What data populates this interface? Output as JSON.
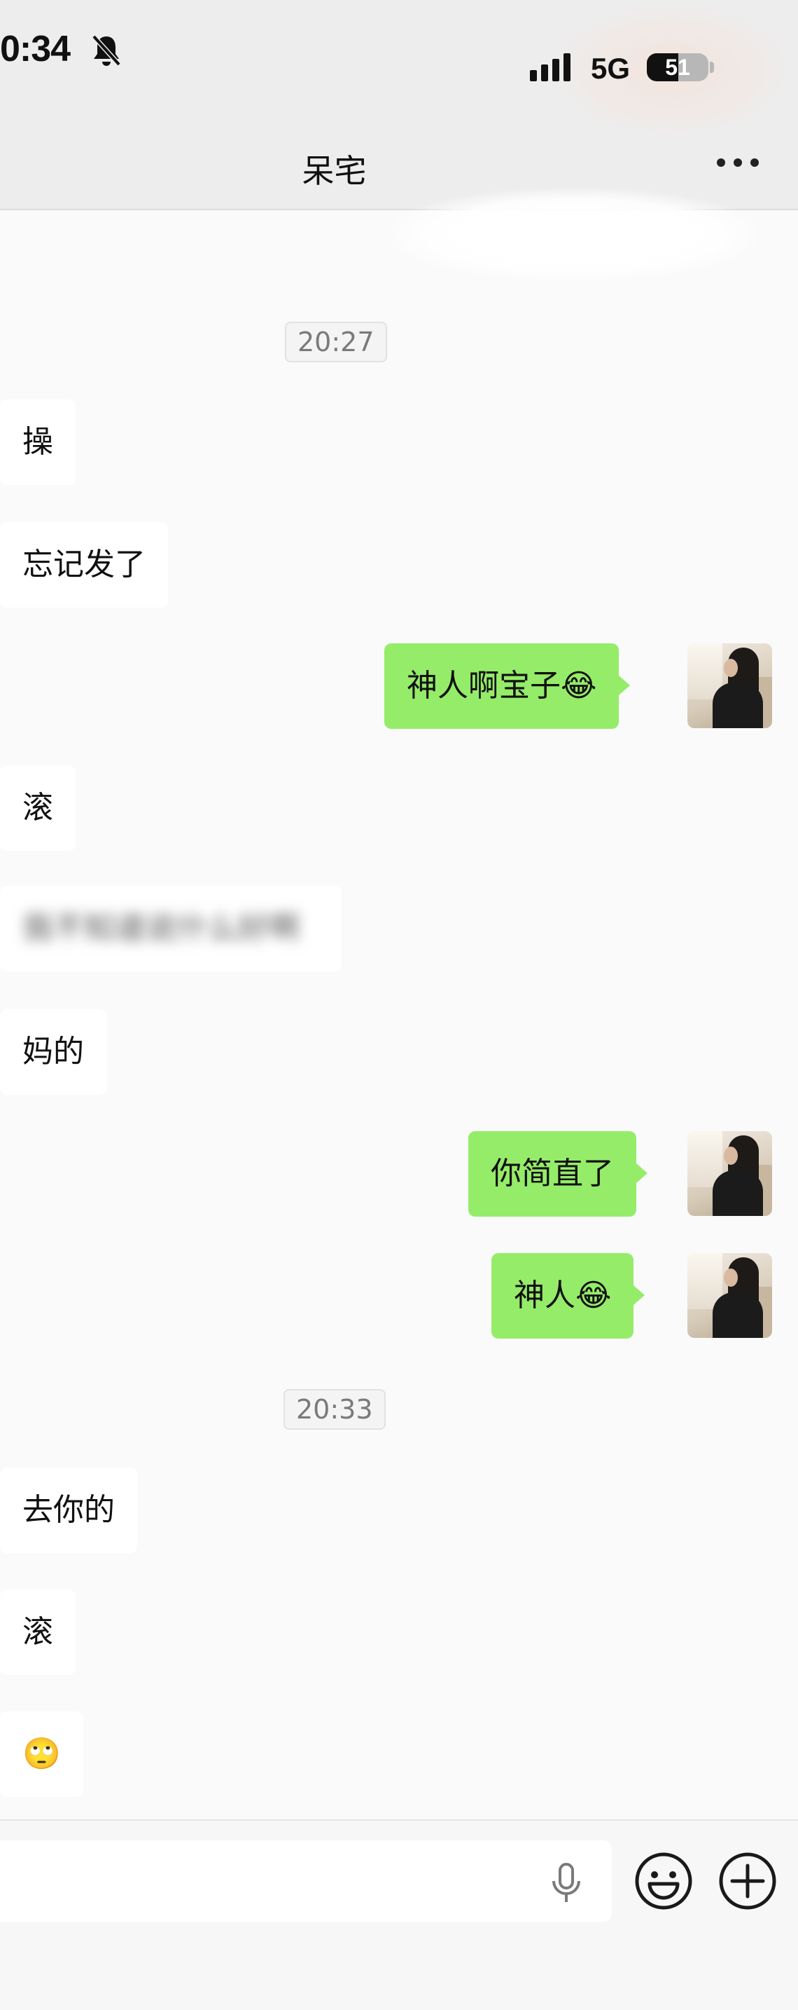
{
  "status_bar": {
    "time": "0:34",
    "network": "5G",
    "battery": "51",
    "battery_level": 0.51
  },
  "header": {
    "title": "呆宅",
    "more_icon": "more-dots-icon"
  },
  "messages": [
    {
      "type": "timestamp",
      "text": "20:27"
    },
    {
      "type": "in",
      "text": "操"
    },
    {
      "type": "in",
      "text": "忘记发了"
    },
    {
      "type": "out",
      "text": "神人啊宝子😂"
    },
    {
      "type": "in",
      "text": "滚"
    },
    {
      "type": "in",
      "text": "我不知道说什么好啊",
      "blurred": true
    },
    {
      "type": "in",
      "text": "妈的"
    },
    {
      "type": "out",
      "text": "你简直了"
    },
    {
      "type": "out",
      "text": "神人😂"
    },
    {
      "type": "timestamp",
      "text": "20:33"
    },
    {
      "type": "in",
      "text": "去你的"
    },
    {
      "type": "in",
      "text": "滚"
    },
    {
      "type": "in",
      "text": "🙄"
    }
  ],
  "input_bar": {
    "placeholder": "",
    "mic_icon": "microphone-icon",
    "emoji_icon": "emoji-face-icon",
    "plus_icon": "plus-circle-icon"
  },
  "colors": {
    "outgoing_bubble": "#95ec69",
    "incoming_bubble": "#ffffff",
    "background": "#fafafa",
    "header": "#ededed"
  }
}
